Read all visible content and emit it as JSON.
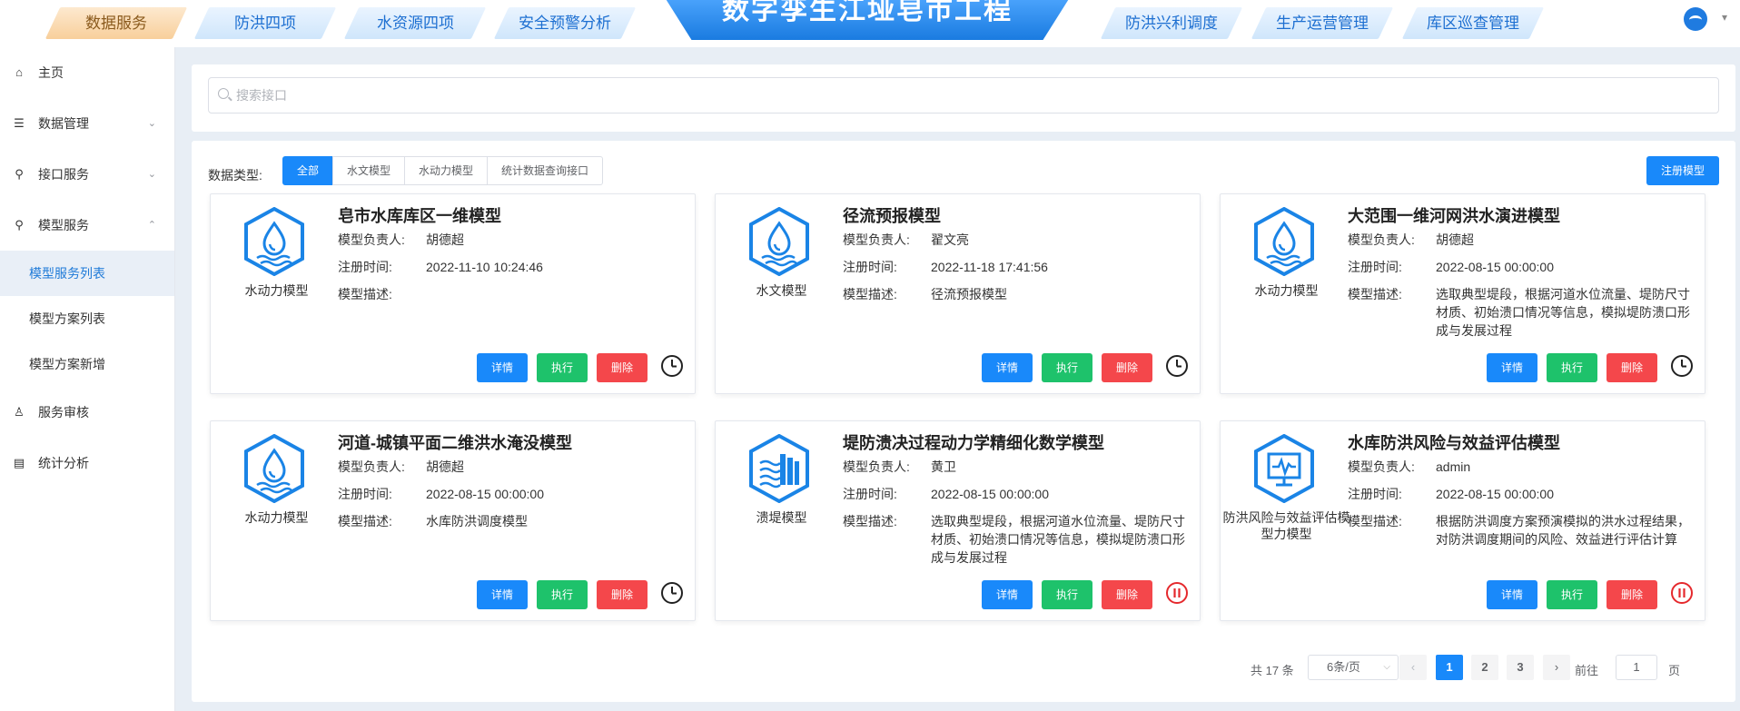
{
  "topnav": {
    "title": "数字孪生江垭皂市工程",
    "tabs": [
      {
        "label": "数据服务",
        "active": true
      },
      {
        "label": "防洪四项"
      },
      {
        "label": "水资源四项"
      },
      {
        "label": "安全预警分析"
      },
      {
        "label": "防洪兴利调度"
      },
      {
        "label": "生产运营管理"
      },
      {
        "label": "库区巡查管理"
      }
    ]
  },
  "sidebar": {
    "items": [
      {
        "label": "主页",
        "icon": "home-icon"
      },
      {
        "label": "数据管理",
        "icon": "database-icon",
        "arrow": "⌄"
      },
      {
        "label": "接口服务",
        "icon": "plug-icon",
        "arrow": "⌄"
      },
      {
        "label": "模型服务",
        "icon": "plug-icon",
        "arrow": "⌃"
      },
      {
        "label": "服务审核",
        "icon": "stamp-icon"
      },
      {
        "label": "统计分析",
        "icon": "chart-icon"
      }
    ],
    "subitems": [
      {
        "label": "模型服务列表",
        "active": true
      },
      {
        "label": "模型方案列表"
      },
      {
        "label": "模型方案新增"
      }
    ]
  },
  "search": {
    "placeholder": "搜索接口"
  },
  "filter": {
    "label": "数据类型:",
    "options": [
      "全部",
      "水文模型",
      "水动力模型",
      "统计数据查询接口"
    ],
    "register_label": "注册模型"
  },
  "labels": {
    "owner": "模型负责人:",
    "time": "注册时间:",
    "desc": "模型描述:"
  },
  "actions": {
    "detail": "详情",
    "exec": "执行",
    "delete": "删除"
  },
  "cards": [
    {
      "title": "皂市水库库区一维模型",
      "type": "水动力模型",
      "icon": "drop-icon",
      "owner": "胡德超",
      "time": "2022-11-10 10:24:46",
      "desc": "",
      "status": "clock"
    },
    {
      "title": "径流预报模型",
      "type": "水文模型",
      "icon": "drop-icon",
      "owner": "翟文亮",
      "time": "2022-11-18 17:41:56",
      "desc": "径流预报模型",
      "status": "clock"
    },
    {
      "title": "大范围一维河网洪水演进模型",
      "type": "水动力模型",
      "icon": "drop-icon",
      "owner": "胡德超",
      "time": "2022-08-15 00:00:00",
      "desc": "选取典型堤段，根据河道水位流量、堤防尺寸材质、初始溃口情况等信息，模拟堤防溃口形成与发展过程",
      "status": "clock"
    },
    {
      "title": "河道-城镇平面二维洪水淹没模型",
      "type": "水动力模型",
      "icon": "drop-icon",
      "owner": "胡德超",
      "time": "2022-08-15 00:00:00",
      "desc": "水库防洪调度模型",
      "status": "clock"
    },
    {
      "title": "堤防溃决过程动力学精细化数学模型",
      "type": "溃堤模型",
      "icon": "levee-icon",
      "owner": "黄卫",
      "time": "2022-08-15 00:00:00",
      "desc": "选取典型堤段，根据河道水位流量、堤防尺寸材质、初始溃口情况等信息，模拟堤防溃口形成与发展过程",
      "status": "pause"
    },
    {
      "title": "水库防洪风险与效益评估模型",
      "type": "防洪风险与效益评估模型力模型",
      "icon": "monitor-icon",
      "owner": "admin",
      "time": "2022-08-15 00:00:00",
      "desc": "根据防洪调度方案预演模拟的洪水过程结果，对防洪调度期间的风险、效益进行评估计算",
      "status": "pause"
    }
  ],
  "pagination": {
    "total": "共 17 条",
    "page_size": "6条/页",
    "pages": [
      "1",
      "2",
      "3"
    ],
    "current": "1",
    "goto_label": "前往",
    "goto_value": "1",
    "unit": "页"
  },
  "colors": {
    "primary": "#1989fa",
    "success": "#1ec26b",
    "danger": "#f4474b"
  }
}
